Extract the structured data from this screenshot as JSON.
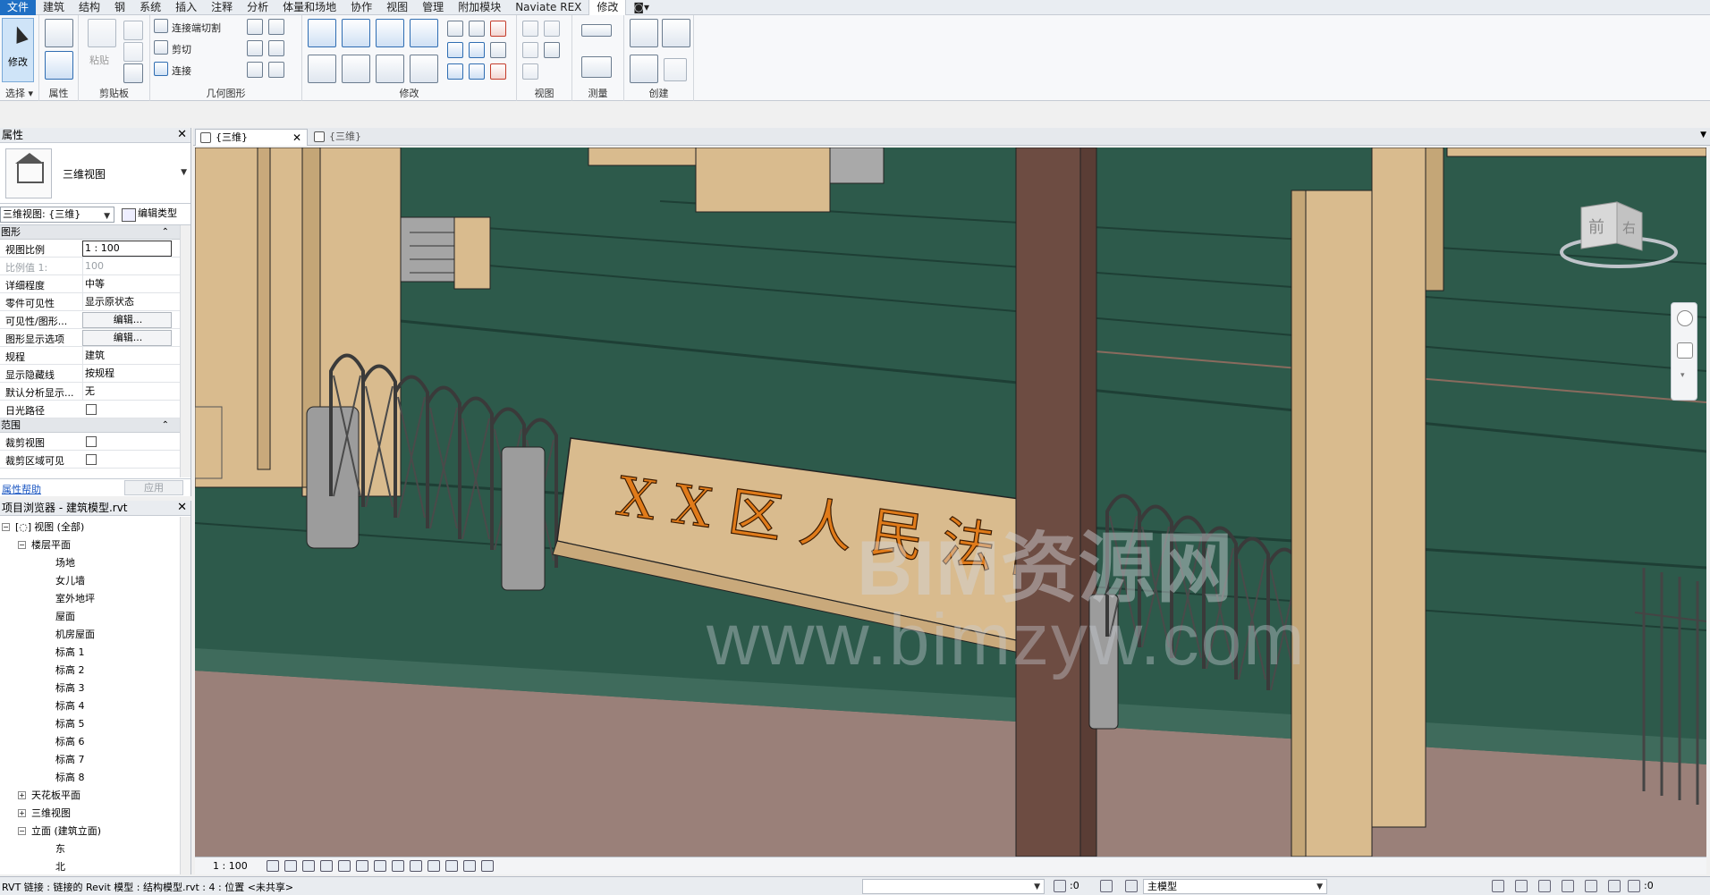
{
  "ribbon": {
    "tabs": [
      "文件",
      "建筑",
      "结构",
      "钢",
      "系统",
      "插入",
      "注释",
      "分析",
      "体量和场地",
      "协作",
      "视图",
      "管理",
      "附加模块",
      "Naviate REX",
      "修改"
    ],
    "active_tab": "修改",
    "panels": {
      "select": {
        "button_label": "修改",
        "label": "选择 ▾"
      },
      "properties": {
        "label": "属性"
      },
      "clipboard": {
        "paste": "粘贴",
        "label": "剪贴板"
      },
      "geometry": {
        "cope": "连接端切割",
        "cut": "剪切",
        "join": "连接",
        "label": "几何图形"
      },
      "modify": {
        "label": "修改"
      },
      "view": {
        "label": "视图"
      },
      "measure": {
        "label": "测量"
      },
      "create": {
        "label": "创建"
      }
    }
  },
  "properties": {
    "title": "属性",
    "type_name": "三维视图",
    "view_selector": "三维视图: {三维}",
    "edit_type": "编辑类型",
    "groups": {
      "graphics": "图形",
      "extents": "范围"
    },
    "rows": [
      {
        "key": "视图比例",
        "value": "1 : 100"
      },
      {
        "key": "比例值 1:",
        "value": "100"
      },
      {
        "key": "详细程度",
        "value": "中等"
      },
      {
        "key": "零件可见性",
        "value": "显示原状态"
      },
      {
        "key": "可见性/图形...",
        "value": "编辑..."
      },
      {
        "key": "图形显示选项",
        "value": "编辑..."
      },
      {
        "key": "规程",
        "value": "建筑"
      },
      {
        "key": "显示隐藏线",
        "value": "按规程"
      },
      {
        "key": "默认分析显示...",
        "value": "无"
      },
      {
        "key": "日光路径",
        "value": ""
      },
      {
        "key": "裁剪视图",
        "value": ""
      },
      {
        "key": "裁剪区域可见",
        "value": ""
      }
    ],
    "help": "属性帮助",
    "apply": "应用"
  },
  "browser": {
    "title": "项目浏览器 - 建筑模型.rvt",
    "root": "视图 (全部)",
    "floor_plans": "楼层平面",
    "floor_plan_items": [
      "场地",
      "女儿墙",
      "室外地坪",
      "屋面",
      "机房屋面",
      "标高 1",
      "标高 2",
      "标高 3",
      "标高 4",
      "标高 5",
      "标高 6",
      "标高 7",
      "标高 8"
    ],
    "ceiling_plans": "天花板平面",
    "views_3d": "三维视图",
    "elevations": "立面 (建筑立面)",
    "elevation_items": [
      "东",
      "北"
    ]
  },
  "doc_tabs": [
    {
      "label": "{三维}",
      "active": true
    },
    {
      "label": "{三维}",
      "active": false
    }
  ],
  "viewport": {
    "sign_text": "XX区人民法院",
    "watermark_line1": "BIM资源网",
    "watermark_line2": "www.bimzyw.com",
    "viewcube_front": "前",
    "viewcube_right": "右"
  },
  "view_control": {
    "scale": "1 : 100"
  },
  "status": {
    "message": "RVT 链接 : 链接的 Revit 模型 : 结构模型.rvt : 4 : 位置 <未共享>",
    "count_left": ":0",
    "model": "主模型",
    "count_right": ":0"
  },
  "colors": {
    "floor": "#2d5a4b",
    "column": "#d9bb8e",
    "column_dark": "#6d4c42",
    "sign_text": "#e07b1a",
    "accent": "#1f6fc4"
  }
}
